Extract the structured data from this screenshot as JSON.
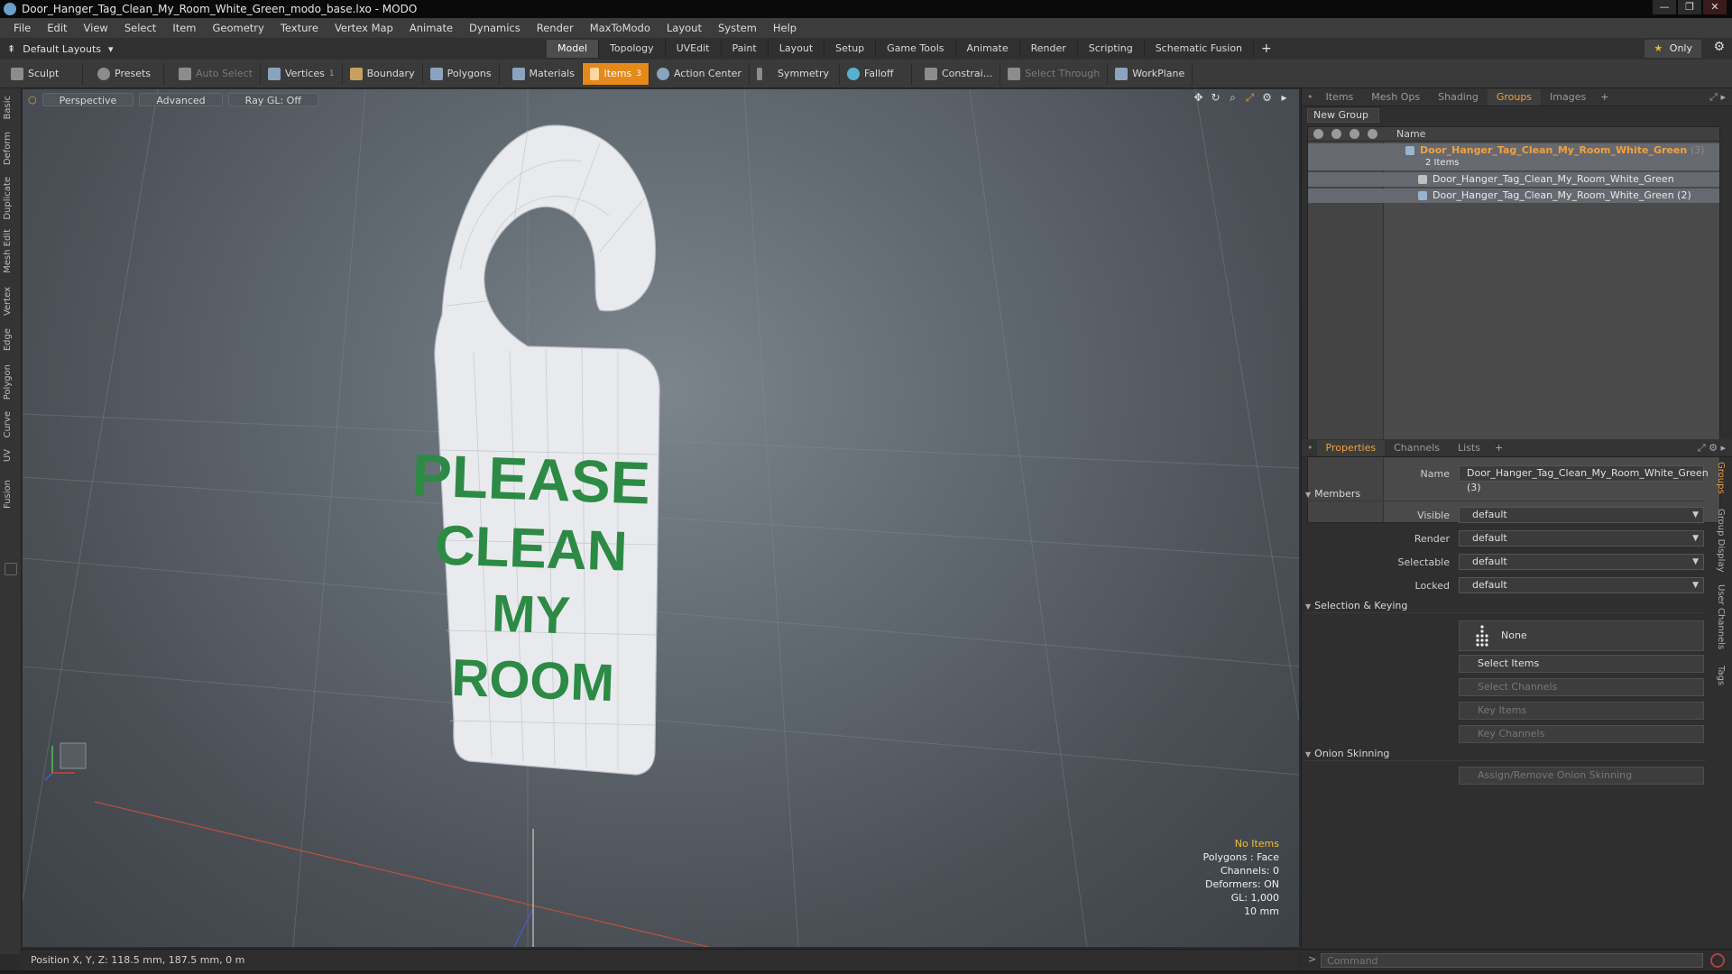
{
  "window": {
    "title": "Door_Hanger_Tag_Clean_My_Room_White_Green_modo_base.lxo - MODO",
    "controls": [
      "—",
      "❐",
      "✕"
    ]
  },
  "menu": [
    "File",
    "Edit",
    "View",
    "Select",
    "Item",
    "Geometry",
    "Texture",
    "Vertex Map",
    "Animate",
    "Dynamics",
    "Render",
    "MaxToModo",
    "Layout",
    "System",
    "Help"
  ],
  "layoutbar": {
    "layouts_label": "Default Layouts",
    "tabs": [
      "Model",
      "Topology",
      "UVEdit",
      "Paint",
      "Layout",
      "Setup",
      "Game Tools",
      "Animate",
      "Render",
      "Scripting",
      "Schematic Fusion"
    ],
    "active_tab": "Model",
    "add_label": "+",
    "only_label": "Only"
  },
  "toolbar": {
    "sculpt": "Sculpt",
    "presets": "Presets",
    "auto_select": "Auto Select",
    "vertices": "Vertices",
    "vertices_count": "1",
    "boundary": "Boundary",
    "polygons": "Polygons",
    "materials": "Materials",
    "items": "Items",
    "items_count": "3",
    "action_center": "Action Center",
    "symmetry": "Symmetry",
    "falloff": "Falloff",
    "constraints": "Constrai...",
    "select_through": "Select Through",
    "workplane": "WorkPlane"
  },
  "left_tabs": [
    "Basic",
    "Deform",
    "Duplicate",
    "Mesh Edit",
    "Vertex",
    "Edge",
    "Polygon",
    "Curve",
    "UV",
    "Fusion"
  ],
  "viewport": {
    "perspective": "Perspective",
    "advanced": "Advanced",
    "raygl": "Ray GL: Off",
    "tag_lines": [
      "PLEASE",
      "CLEAN",
      "MY",
      "ROOM"
    ],
    "tag_text_color": "#2d8a45",
    "info": {
      "no_items": "No Items",
      "polygons": "Polygons : Face",
      "channels": "Channels: 0",
      "deformers": "Deformers: ON",
      "gl": "GL: 1,000",
      "scale": "10 mm"
    }
  },
  "status": {
    "position": "Position X, Y, Z:   118.5 mm, 187.5 mm, 0 m"
  },
  "groups_panel": {
    "tabs": [
      "Items",
      "Mesh Ops",
      "Shading",
      "Groups",
      "Images"
    ],
    "active_tab": "Groups",
    "new_group": "New Group",
    "name_header": "Name",
    "group_name": "Door_Hanger_Tag_Clean_My_Room_White_Green",
    "group_count": "(3)",
    "items_count": "2 Items",
    "members": [
      "Door_Hanger_Tag_Clean_My_Room_White_Green",
      "Door_Hanger_Tag_Clean_My_Room_White_Green (2)"
    ]
  },
  "properties_panel": {
    "tabs": [
      "Properties",
      "Channels",
      "Lists"
    ],
    "active_tab": "Properties",
    "name_label": "Name",
    "name_value": "Door_Hanger_Tag_Clean_My_Room_White_Green (3)",
    "members_section": "Members",
    "visible_label": "Visible",
    "visible_value": "default",
    "render_label": "Render",
    "render_value": "default",
    "selectable_label": "Selectable",
    "selectable_value": "default",
    "locked_label": "Locked",
    "locked_value": "default",
    "selkey_section": "Selection & Keying",
    "none_label": "None",
    "select_items": "Select Items",
    "select_channels": "Select Channels",
    "key_items": "Key Items",
    "key_channels": "Key Channels",
    "onion_section": "Onion Skinning",
    "assign_onion": "Assign/Remove Onion Skinning",
    "side_tabs": [
      "Groups",
      "Group Display",
      "User Channels",
      "Tags"
    ]
  },
  "command": {
    "placeholder": "Command"
  }
}
